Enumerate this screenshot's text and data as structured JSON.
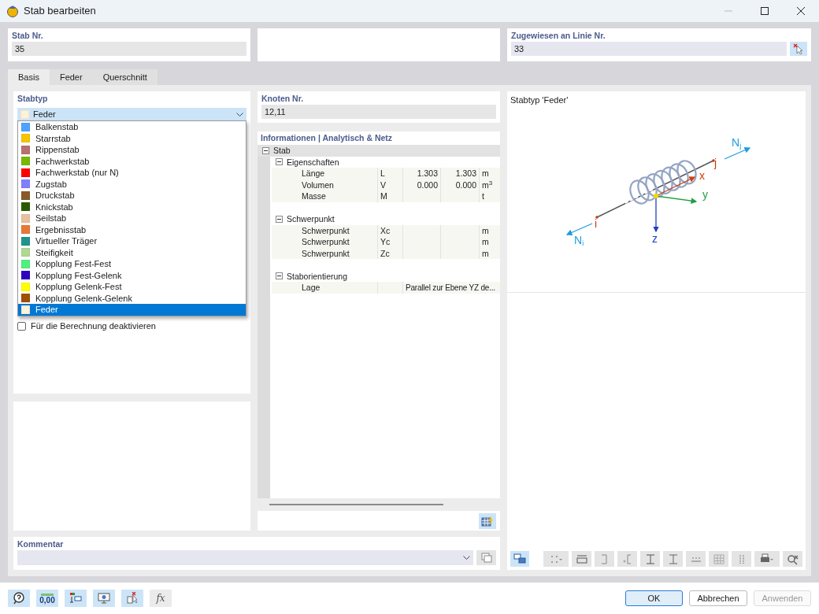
{
  "window": {
    "title": "Stab bearbeiten"
  },
  "header": {
    "member_no": {
      "label": "Stab Nr.",
      "value": "35"
    },
    "line_no": {
      "label": "Zugewiesen an Linie Nr.",
      "value": "33"
    }
  },
  "tabs": [
    {
      "label": "Basis",
      "selected": true
    },
    {
      "label": "Feder",
      "selected": false
    },
    {
      "label": "Querschnitt",
      "selected": false
    }
  ],
  "member_type": {
    "label": "Stabtyp",
    "value": "Feder",
    "expanded": true,
    "options": [
      {
        "label": "Balkenstab",
        "color": "#4da3ff",
        "selected": false
      },
      {
        "label": "Starrstab",
        "color": "#f5c400",
        "selected": false
      },
      {
        "label": "Rippenstab",
        "color": "#b87070",
        "selected": false
      },
      {
        "label": "Fachwerkstab",
        "color": "#78b800",
        "selected": false
      },
      {
        "label": "Fachwerkstab (nur N)",
        "color": "#ff0000",
        "selected": false
      },
      {
        "label": "Zugstab",
        "color": "#8080ff",
        "selected": false
      },
      {
        "label": "Druckstab",
        "color": "#8b5a2b",
        "selected": false
      },
      {
        "label": "Knickstab",
        "color": "#2d5a00",
        "selected": false
      },
      {
        "label": "Seilstab",
        "color": "#e8c0a0",
        "selected": false
      },
      {
        "label": "Ergebnisstab",
        "color": "#e87838",
        "selected": false
      },
      {
        "label": "Virtueller Träger",
        "color": "#20948c",
        "selected": false
      },
      {
        "label": "Steifigkeit",
        "color": "#b0d890",
        "selected": false
      },
      {
        "label": "Kopplung Fest-Fest",
        "color": "#50f080",
        "selected": false
      },
      {
        "label": "Kopplung Fest-Gelenk",
        "color": "#3000c0",
        "selected": false
      },
      {
        "label": "Kopplung Gelenk-Fest",
        "color": "#ffff00",
        "selected": false
      },
      {
        "label": "Kopplung Gelenk-Gelenk",
        "color": "#a05000",
        "selected": false
      },
      {
        "label": "Feder",
        "color": "#fff2d8",
        "selected": true
      }
    ]
  },
  "deactivate": {
    "label": "Für die Berechnung deaktivieren",
    "checked": false
  },
  "nodes": {
    "label": "Knoten Nr.",
    "value": "12,11"
  },
  "info": {
    "title": "Informationen | Analytisch & Netz",
    "tree": [
      {
        "label": "Stab",
        "expanded": true,
        "children": [
          {
            "label": "Eigenschaften",
            "expanded": true,
            "children": [
              {
                "kind": "numeric",
                "label": "Länge",
                "symbol": "L",
                "value_1": "1.303",
                "value_2": "1.303",
                "unit": "m"
              },
              {
                "kind": "numeric",
                "label": "Volumen",
                "symbol": "V",
                "value_1": "0.000",
                "value_2": "0.000",
                "unit": "m$^{3}$"
              },
              {
                "kind": "numeric",
                "label": "Masse",
                "symbol": "M",
                "unit": "t"
              }
            ]
          },
          {
            "label": "Schwerpunkt",
            "expanded": true,
            "children": [
              {
                "kind": "numeric",
                "label": "Schwerpunkt",
                "symbol": "Xc",
                "unit": "m"
              },
              {
                "kind": "numeric",
                "label": "Schwerpunkt",
                "symbol": "Yc",
                "unit": "m"
              },
              {
                "kind": "numeric",
                "label": "Schwerpunkt",
                "symbol": "Zc",
                "unit": "m"
              }
            ]
          },
          {
            "label": "Staborientierung",
            "expanded": true,
            "children": [
              {
                "kind": "text",
                "label": "Lage",
                "value": "Parallel zur Ebene YZ de..."
              }
            ]
          }
        ]
      }
    ]
  },
  "comment": {
    "label": "Kommentar"
  },
  "diagram": {
    "title": "Stabtyp 'Feder'",
    "labels": [
      {
        "kind": "force",
        "text": "N$_{j}$"
      },
      {
        "kind": "node",
        "text": "j"
      },
      {
        "kind": "axis_x",
        "text": "x"
      },
      {
        "kind": "axis_y",
        "text": "y"
      },
      {
        "kind": "node",
        "text": "i"
      },
      {
        "kind": "axis_z",
        "text": "z"
      },
      {
        "kind": "force",
        "text": "N$_{i}$"
      }
    ]
  },
  "footer_tools": [
    {
      "kind": "help",
      "active": true
    },
    {
      "kind": "decimals",
      "text": "0,00",
      "active": true
    },
    {
      "kind": "display",
      "active": true
    },
    {
      "kind": "view",
      "active": true
    },
    {
      "kind": "deselect",
      "active": true
    },
    {
      "kind": "formula",
      "text": "fx",
      "active": false
    }
  ],
  "buttons": [
    {
      "label": "OK",
      "kind": "default",
      "disabled": false
    },
    {
      "label": "Abbrechen",
      "kind": "normal",
      "disabled": false
    },
    {
      "label": "Anwenden",
      "kind": "normal",
      "disabled": true
    }
  ]
}
